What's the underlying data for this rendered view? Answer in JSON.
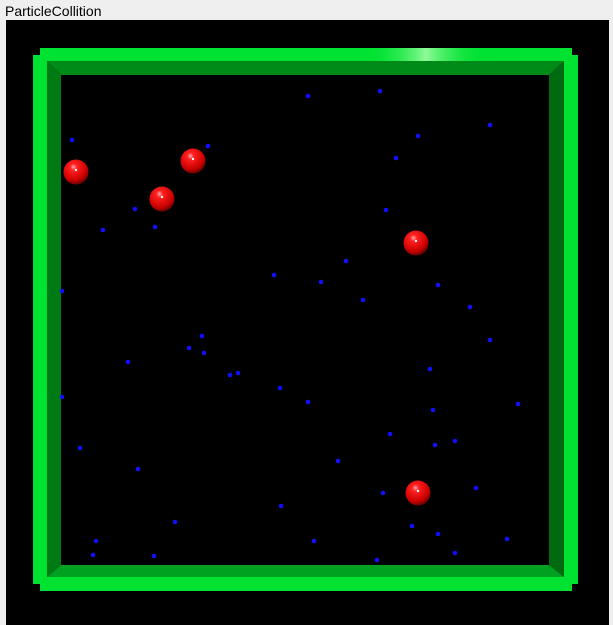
{
  "window": {
    "title": "ParticleCollition"
  },
  "scene": {
    "background_color": "#000000",
    "wall_color_light": "#00e232",
    "wall_color_mid": "#00c42a",
    "wall_color_dark": "#007a12",
    "wall_color_darker": "#00600e",
    "large_particle_color": "#ff0000",
    "small_particle_color": "#1010ff",
    "large_particle_count": 5,
    "small_particle_count": 56
  }
}
